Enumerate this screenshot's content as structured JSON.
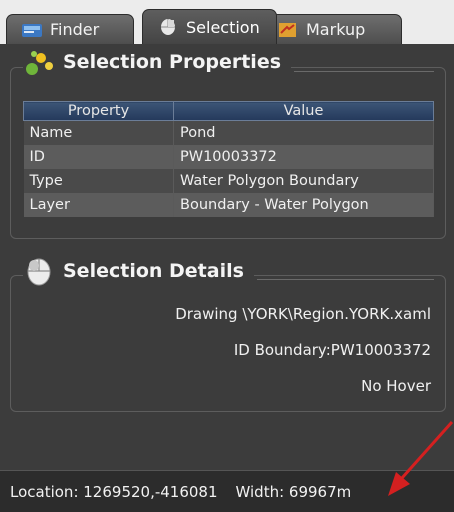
{
  "tabs": [
    {
      "label": "Finder",
      "icon": "finder-icon",
      "active": false
    },
    {
      "label": "Selection",
      "icon": "cursor-icon",
      "active": true
    },
    {
      "label": "Markup",
      "icon": "markup-icon",
      "active": false
    }
  ],
  "selection_properties": {
    "title": "Selection Properties",
    "columns": [
      "Property",
      "Value"
    ],
    "rows": [
      {
        "property": "Name",
        "value": "Pond"
      },
      {
        "property": "ID",
        "value": "PW10003372"
      },
      {
        "property": "Type",
        "value": "Water Polygon Boundary"
      },
      {
        "property": "Layer",
        "value": "Boundary - Water Polygon"
      }
    ]
  },
  "selection_details": {
    "title": "Selection Details",
    "lines": [
      "Drawing \\YORK\\Region.YORK.xaml",
      "ID Boundary:PW10003372",
      "No Hover"
    ]
  },
  "status": {
    "location": "Location: 1269520,-416081",
    "width": "Width: 69967m"
  },
  "colors": {
    "panel_bg": "#3c3c3c",
    "table_header": "#2d4566",
    "annotation_arrow": "#d42020"
  }
}
